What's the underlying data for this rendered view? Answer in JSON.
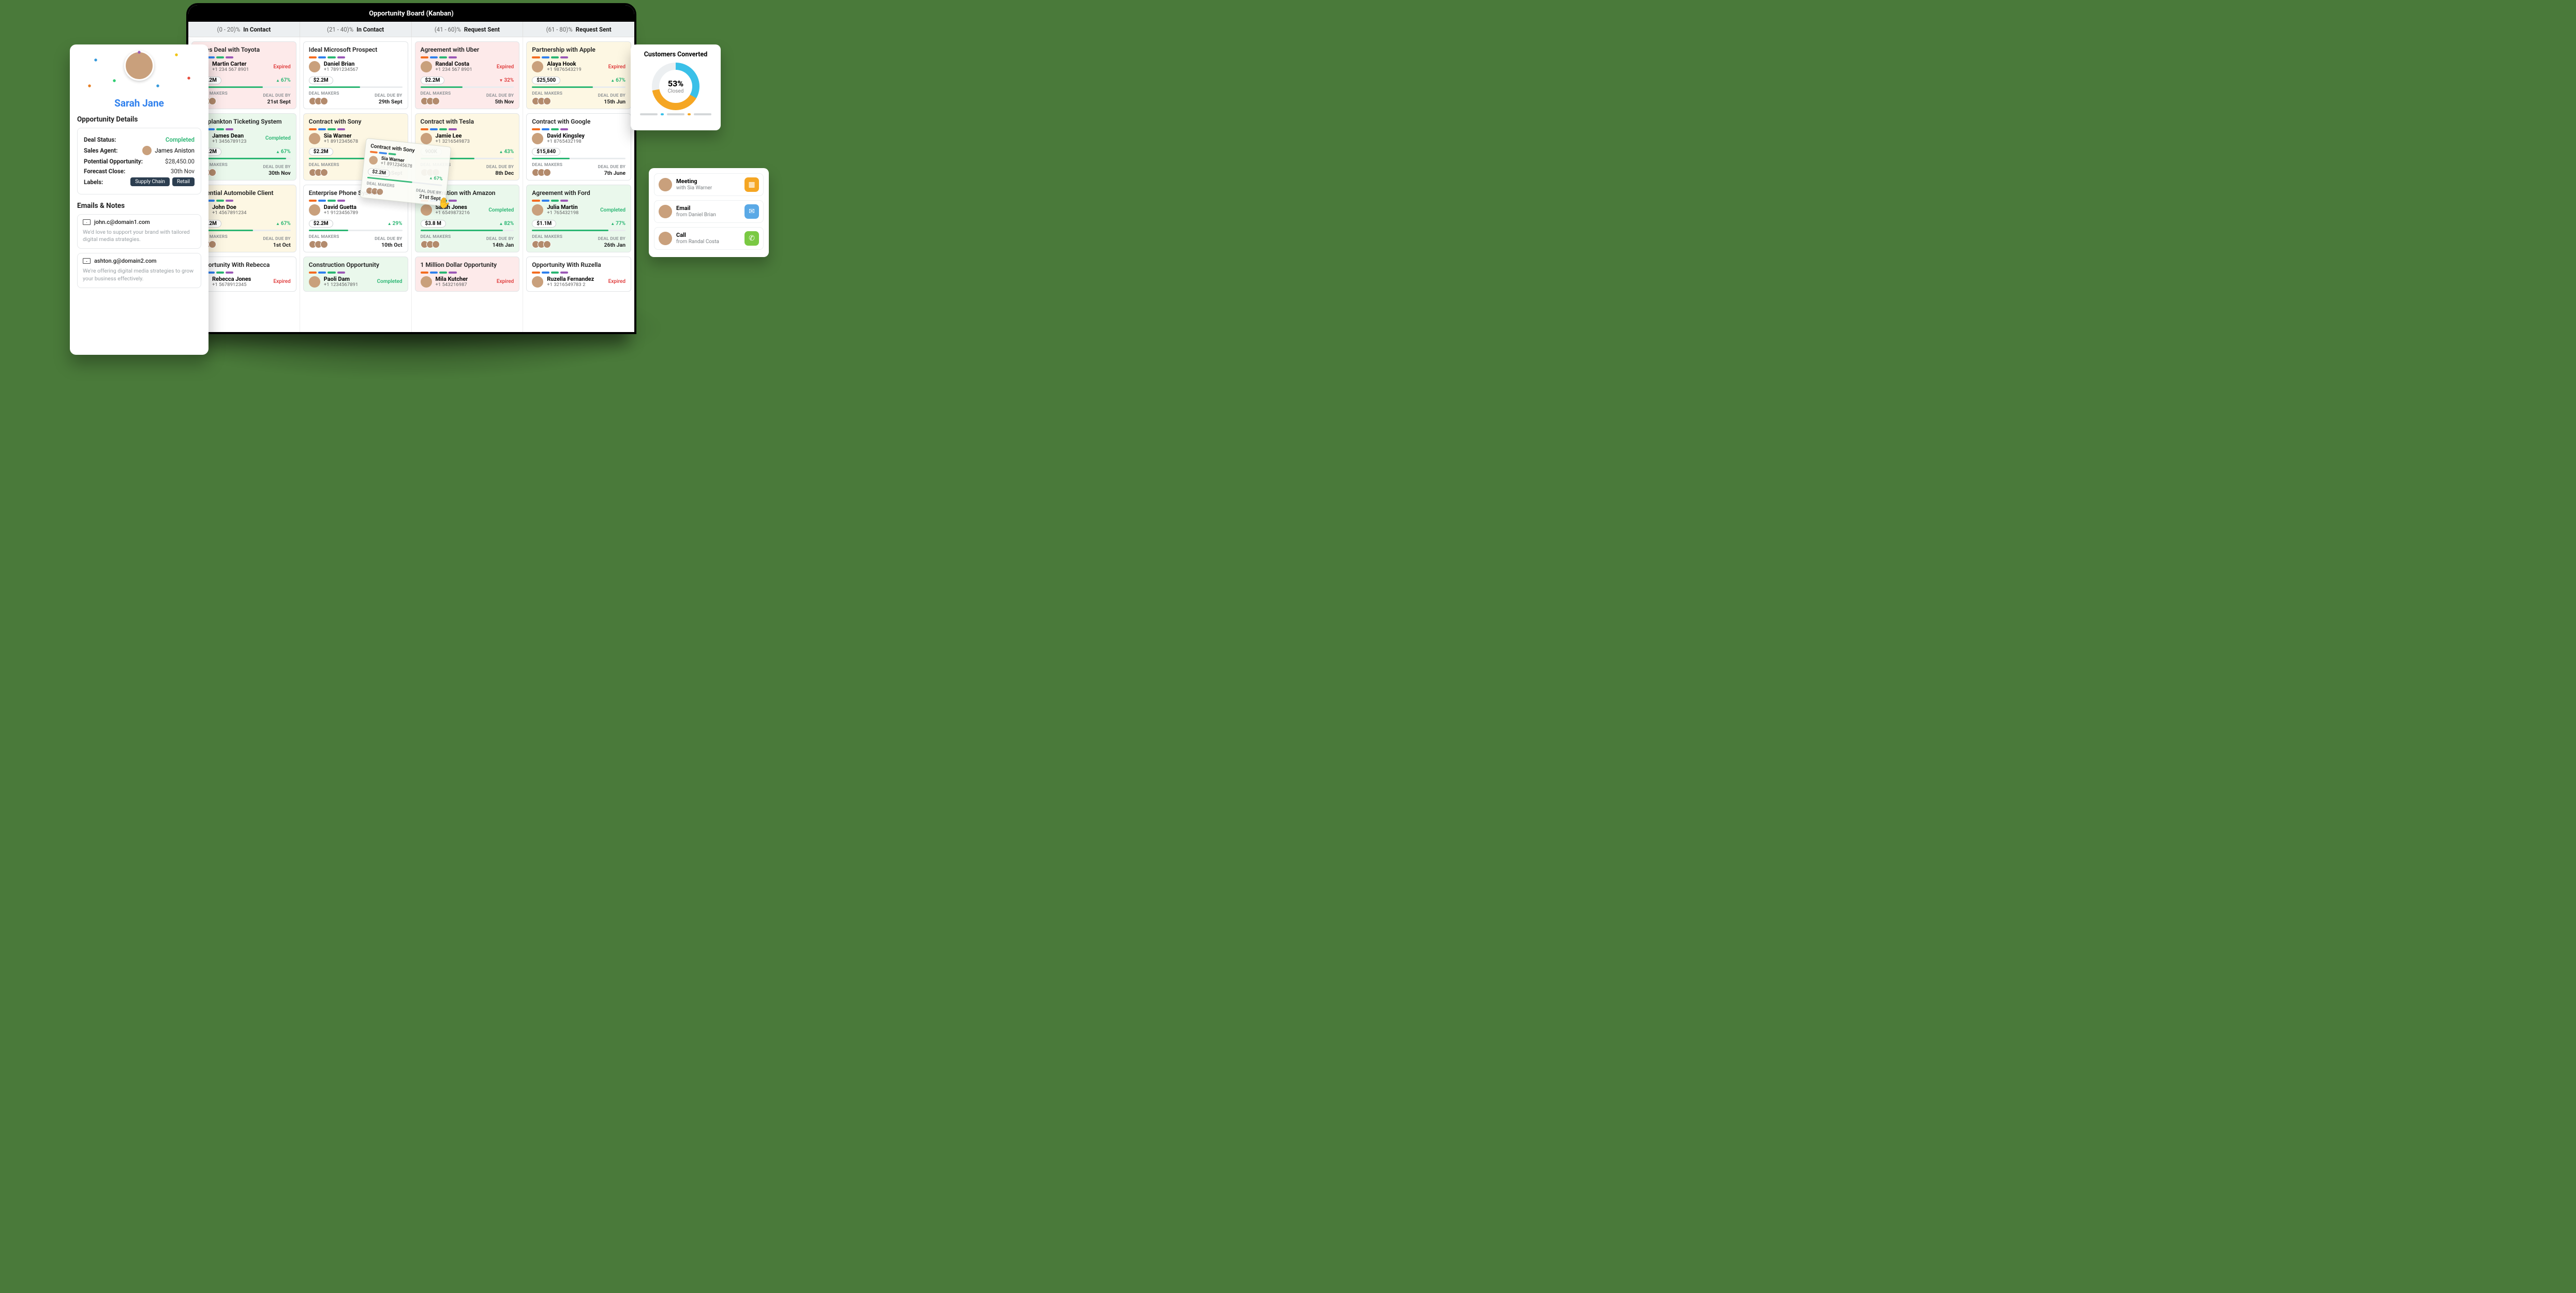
{
  "window_title": "Opportunity Board (Kanban)",
  "columns": [
    {
      "pct": "(0 - 20)%",
      "label": "In Contact"
    },
    {
      "pct": "(21 - 40)%",
      "label": "In Contact"
    },
    {
      "pct": "(41 - 60)%",
      "label": "Request Sent"
    },
    {
      "pct": "(61 - 80)%",
      "label": "Request Sent"
    }
  ],
  "labels": {
    "makers": "DEAL MAKERS",
    "due": "DEAL DUE BY"
  },
  "cards": {
    "c0": [
      {
        "bg": "red",
        "title": "Sales Deal with Toyota",
        "name": "Martin Carter",
        "phone": "+1 234 567 8901",
        "status": "Expired",
        "amount": "$2.2M",
        "delta": "67%",
        "dir": "up",
        "due": "21st Sept",
        "prog": 70
      },
      {
        "bg": "green",
        "title": "Zooplankton Ticketing System",
        "name": "James Dean",
        "phone": "+1 3456789123",
        "status": "Completed",
        "amount": "$2.2M",
        "delta": "67%",
        "dir": "up",
        "due": "30th Nov",
        "prog": 95
      },
      {
        "bg": "yellow",
        "title": "Potential Automobile Client",
        "name": "John Doe",
        "phone": "+1 4567891234",
        "status": "",
        "amount": "$2.2M",
        "delta": "67%",
        "dir": "up",
        "due": "1st Oct",
        "prog": 60
      },
      {
        "bg": "white",
        "title": "Opportunity With Rebecca",
        "name": "Rebecca Jones",
        "phone": "+1 5678912345",
        "status": "Expired",
        "amount": "",
        "delta": "",
        "dir": "",
        "due": "",
        "prog": 0
      }
    ],
    "c1": [
      {
        "bg": "white",
        "title": "Ideal Microsoft Prospect",
        "name": "Daniel Brian",
        "phone": "+1 7891234567",
        "status": "",
        "amount": "$2.2M",
        "delta": "",
        "dir": "",
        "due": "29th Sept",
        "prog": 55
      },
      {
        "bg": "yellow",
        "title": "Contract with Sony",
        "name": "Sia Warner",
        "phone": "+1 8912345678",
        "status": "",
        "amount": "$2.2M",
        "delta": "",
        "dir": "",
        "due": "21st Sept",
        "prog": 60
      },
      {
        "bg": "white",
        "title": "Enterprise Phone System",
        "name": "David Guetta",
        "phone": "+1 9123456789",
        "status": "",
        "amount": "$2.2M",
        "delta": "29%",
        "dir": "up",
        "due": "10th Oct",
        "prog": 42
      },
      {
        "bg": "green",
        "title": "Construction Opportunity",
        "name": "Paoli Dam",
        "phone": "+1 1234567891",
        "status": "Completed",
        "amount": "",
        "delta": "",
        "dir": "",
        "due": "",
        "prog": 0
      }
    ],
    "c2": [
      {
        "bg": "red",
        "title": "Agreement with Uber",
        "name": "Randal Costa",
        "phone": "+1 234 567 8901",
        "status": "Expired",
        "amount": "$2.2M",
        "delta": "32%",
        "dir": "down",
        "due": "5th Nov",
        "prog": 45
      },
      {
        "bg": "yellow",
        "title": "Contract with Tesla",
        "name": "Jamie Lee",
        "phone": "+1 3216549873",
        "status": "",
        "amount": "900K",
        "delta": "43%",
        "dir": "up",
        "due": "8th Dec",
        "prog": 58
      },
      {
        "bg": "green",
        "title": "Collaboration with Amazon",
        "name": "Sarah Jones",
        "phone": "+1 6549873216",
        "status": "Completed",
        "amount": "$3.8 M",
        "delta": "82%",
        "dir": "up",
        "due": "14th Jan",
        "prog": 88
      },
      {
        "bg": "red",
        "title": "1 Million Dollar Opportunity",
        "name": "Mila Kutcher",
        "phone": "+1 543216987",
        "status": "Expired",
        "amount": "",
        "delta": "",
        "dir": "",
        "due": "",
        "prog": 0
      }
    ],
    "c3": [
      {
        "bg": "yellow",
        "title": "Partnership with Apple",
        "name": "Alaya Hook",
        "phone": "+1 9876543219",
        "status": "Expired",
        "amount": "$25,500",
        "delta": "67%",
        "dir": "up",
        "due": "15th Jun",
        "prog": 65
      },
      {
        "bg": "white",
        "title": "Contract with Google",
        "name": "David Kingsley",
        "phone": "+1 8765432198",
        "status": "",
        "amount": "$15,840",
        "delta": "",
        "dir": "",
        "due": "7th June",
        "prog": 40
      },
      {
        "bg": "green",
        "title": "Agreement with Ford",
        "name": "Julia Martin",
        "phone": "+1 765432198",
        "status": "Completed",
        "amount": "$1.1M",
        "delta": "77%",
        "dir": "up",
        "due": "26th Jan",
        "prog": 82
      },
      {
        "bg": "white",
        "title": "Opportunity With Ruzella",
        "name": "Ruzella Fernandez",
        "phone": "+1 3216549783 2",
        "status": "Expired",
        "amount": "",
        "delta": "",
        "dir": "",
        "due": "",
        "prog": 0
      }
    ]
  },
  "details": {
    "customer": "Sarah Jane",
    "heading": "Opportunity Details",
    "rows": {
      "status_l": "Deal Status:",
      "status_v": "Completed",
      "agent_l": "Sales Agent:",
      "agent_v": "James Aniston",
      "pot_l": "Potential Opportunity:",
      "pot_v": "$28,450.00",
      "close_l": "Forecast Close:",
      "close_v": "30th Nov",
      "labels_l": "Labels:"
    },
    "pills": [
      "Supply Chain",
      "Retail"
    ],
    "emails_h": "Emails & Notes",
    "emails": [
      {
        "addr": "john.c@domain1.com",
        "body": "We'd love to support your brand with tailored digital media strategies."
      },
      {
        "addr": "ashton.g@domain2.com",
        "body": "We're offering digital media strategies to grow your business effectively."
      }
    ]
  },
  "drag": {
    "title": "Contract with Sony",
    "name": "Sia Warner",
    "phone": "+1 8912345678",
    "amount": "$2.2M",
    "delta": "67%",
    "due": "21st Sept"
  },
  "converted": {
    "title": "Customers Converted",
    "pct": "53%",
    "label": "Closed"
  },
  "activities": [
    {
      "type": "Meeting",
      "sub": "with Sia Warner",
      "icon": "cal"
    },
    {
      "type": "Email",
      "sub": "from Daniel Brian",
      "icon": "mail"
    },
    {
      "type": "Call",
      "sub": "from Randal Costa",
      "icon": "phone"
    }
  ]
}
